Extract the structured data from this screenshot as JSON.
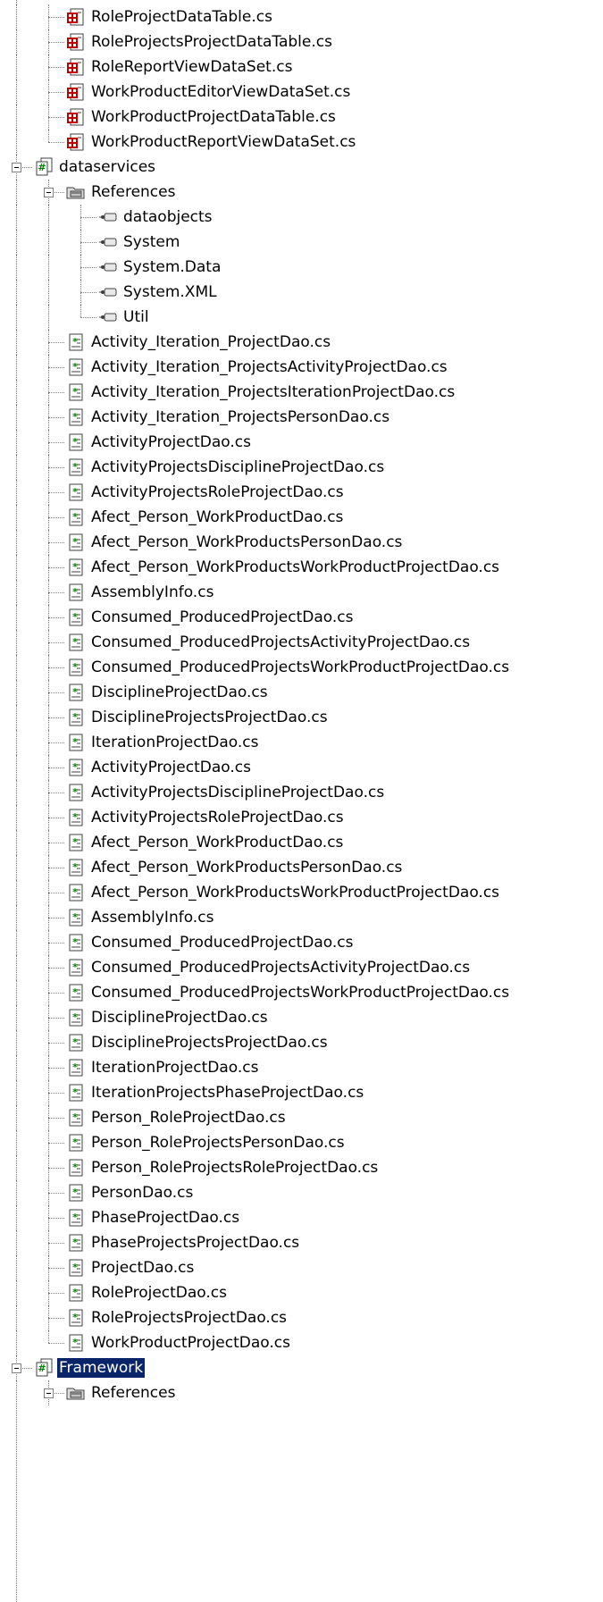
{
  "tree": {
    "nodes": [
      {
        "label": "RoleProjectDataTable.cs",
        "depth": 2,
        "type": "dataset",
        "expanded": false,
        "hasChildren": false,
        "last": false,
        "ancestorLastFlags": [
          false,
          false
        ]
      },
      {
        "label": "RoleProjectsProjectDataTable.cs",
        "depth": 2,
        "type": "dataset",
        "expanded": false,
        "hasChildren": false,
        "last": false,
        "ancestorLastFlags": [
          false,
          false
        ]
      },
      {
        "label": "RoleReportViewDataSet.cs",
        "depth": 2,
        "type": "dataset",
        "expanded": false,
        "hasChildren": false,
        "last": false,
        "ancestorLastFlags": [
          false,
          false
        ]
      },
      {
        "label": "WorkProductEditorViewDataSet.cs",
        "depth": 2,
        "type": "dataset",
        "expanded": false,
        "hasChildren": false,
        "last": false,
        "ancestorLastFlags": [
          false,
          false
        ]
      },
      {
        "label": "WorkProductProjectDataTable.cs",
        "depth": 2,
        "type": "dataset",
        "expanded": false,
        "hasChildren": false,
        "last": false,
        "ancestorLastFlags": [
          false,
          false
        ]
      },
      {
        "label": "WorkProductReportViewDataSet.cs",
        "depth": 2,
        "type": "dataset",
        "expanded": false,
        "hasChildren": false,
        "last": true,
        "ancestorLastFlags": [
          false,
          false
        ]
      },
      {
        "label": "dataservices",
        "depth": 1,
        "type": "project",
        "expanded": true,
        "hasChildren": true,
        "last": false,
        "ancestorLastFlags": [
          false
        ]
      },
      {
        "label": "References",
        "depth": 2,
        "type": "references",
        "expanded": true,
        "hasChildren": true,
        "last": false,
        "ancestorLastFlags": [
          false,
          false
        ]
      },
      {
        "label": "dataobjects",
        "depth": 3,
        "type": "reference",
        "expanded": false,
        "hasChildren": false,
        "last": false,
        "ancestorLastFlags": [
          false,
          false,
          false
        ]
      },
      {
        "label": "System",
        "depth": 3,
        "type": "reference",
        "expanded": false,
        "hasChildren": false,
        "last": false,
        "ancestorLastFlags": [
          false,
          false,
          false
        ]
      },
      {
        "label": "System.Data",
        "depth": 3,
        "type": "reference",
        "expanded": false,
        "hasChildren": false,
        "last": false,
        "ancestorLastFlags": [
          false,
          false,
          false
        ]
      },
      {
        "label": "System.XML",
        "depth": 3,
        "type": "reference",
        "expanded": false,
        "hasChildren": false,
        "last": false,
        "ancestorLastFlags": [
          false,
          false,
          false
        ]
      },
      {
        "label": "Util",
        "depth": 3,
        "type": "reference",
        "expanded": false,
        "hasChildren": false,
        "last": true,
        "ancestorLastFlags": [
          false,
          false,
          false
        ]
      },
      {
        "label": "Activity_Iteration_ProjectDao.cs",
        "depth": 2,
        "type": "csfile",
        "last": false
      },
      {
        "label": "Activity_Iteration_ProjectsActivityProjectDao.cs",
        "depth": 2,
        "type": "csfile",
        "last": false
      },
      {
        "label": "Activity_Iteration_ProjectsIterationProjectDao.cs",
        "depth": 2,
        "type": "csfile",
        "last": false
      },
      {
        "label": "Activity_Iteration_ProjectsPersonDao.cs",
        "depth": 2,
        "type": "csfile",
        "last": false
      },
      {
        "label": "ActivityProjectDao.cs",
        "depth": 2,
        "type": "csfile",
        "last": false
      },
      {
        "label": "ActivityProjectsDisciplineProjectDao.cs",
        "depth": 2,
        "type": "csfile",
        "last": false
      },
      {
        "label": "ActivityProjectsRoleProjectDao.cs",
        "depth": 2,
        "type": "csfile",
        "last": false
      },
      {
        "label": "Afect_Person_WorkProductDao.cs",
        "depth": 2,
        "type": "csfile",
        "last": false
      },
      {
        "label": "Afect_Person_WorkProductsPersonDao.cs",
        "depth": 2,
        "type": "csfile",
        "last": false
      },
      {
        "label": "Afect_Person_WorkProductsWorkProductProjectDao.cs",
        "depth": 2,
        "type": "csfile",
        "last": false
      },
      {
        "label": "AssemblyInfo.cs",
        "depth": 2,
        "type": "csfile",
        "last": false
      },
      {
        "label": "Consumed_ProducedProjectDao.cs",
        "depth": 2,
        "type": "csfile",
        "last": false
      },
      {
        "label": "Consumed_ProducedProjectsActivityProjectDao.cs",
        "depth": 2,
        "type": "csfile",
        "last": false
      },
      {
        "label": "Consumed_ProducedProjectsWorkProductProjectDao.cs",
        "depth": 2,
        "type": "csfile",
        "last": false
      },
      {
        "label": "DisciplineProjectDao.cs",
        "depth": 2,
        "type": "csfile",
        "last": false
      },
      {
        "label": "DisciplineProjectsProjectDao.cs",
        "depth": 2,
        "type": "csfile",
        "last": false
      },
      {
        "label": "IterationProjectDao.cs",
        "depth": 2,
        "type": "csfile",
        "last": false
      },
      {
        "label": "ActivityProjectDao.cs",
        "depth": 2,
        "type": "csfile",
        "last": false
      },
      {
        "label": "ActivityProjectsDisciplineProjectDao.cs",
        "depth": 2,
        "type": "csfile",
        "last": false
      },
      {
        "label": "ActivityProjectsRoleProjectDao.cs",
        "depth": 2,
        "type": "csfile",
        "last": false
      },
      {
        "label": "Afect_Person_WorkProductDao.cs",
        "depth": 2,
        "type": "csfile",
        "last": false
      },
      {
        "label": "Afect_Person_WorkProductsPersonDao.cs",
        "depth": 2,
        "type": "csfile",
        "last": false
      },
      {
        "label": "Afect_Person_WorkProductsWorkProductProjectDao.cs",
        "depth": 2,
        "type": "csfile",
        "last": false
      },
      {
        "label": "AssemblyInfo.cs",
        "depth": 2,
        "type": "csfile",
        "last": false
      },
      {
        "label": "Consumed_ProducedProjectDao.cs",
        "depth": 2,
        "type": "csfile",
        "last": false
      },
      {
        "label": "Consumed_ProducedProjectsActivityProjectDao.cs",
        "depth": 2,
        "type": "csfile",
        "last": false
      },
      {
        "label": "Consumed_ProducedProjectsWorkProductProjectDao.cs",
        "depth": 2,
        "type": "csfile",
        "last": false
      },
      {
        "label": "DisciplineProjectDao.cs",
        "depth": 2,
        "type": "csfile",
        "last": false
      },
      {
        "label": "DisciplineProjectsProjectDao.cs",
        "depth": 2,
        "type": "csfile",
        "last": false
      },
      {
        "label": "IterationProjectDao.cs",
        "depth": 2,
        "type": "csfile",
        "last": false
      },
      {
        "label": "IterationProjectsPhaseProjectDao.cs",
        "depth": 2,
        "type": "csfile",
        "last": false
      },
      {
        "label": "Person_RoleProjectDao.cs",
        "depth": 2,
        "type": "csfile",
        "last": false
      },
      {
        "label": "Person_RoleProjectsPersonDao.cs",
        "depth": 2,
        "type": "csfile",
        "last": false
      },
      {
        "label": "Person_RoleProjectsRoleProjectDao.cs",
        "depth": 2,
        "type": "csfile",
        "last": false
      },
      {
        "label": "PersonDao.cs",
        "depth": 2,
        "type": "csfile",
        "last": false
      },
      {
        "label": "PhaseProjectDao.cs",
        "depth": 2,
        "type": "csfile",
        "last": false
      },
      {
        "label": "PhaseProjectsProjectDao.cs",
        "depth": 2,
        "type": "csfile",
        "last": false
      },
      {
        "label": "ProjectDao.cs",
        "depth": 2,
        "type": "csfile",
        "last": false
      },
      {
        "label": "RoleProjectDao.cs",
        "depth": 2,
        "type": "csfile",
        "last": false
      },
      {
        "label": "RoleProjectsProjectDao.cs",
        "depth": 2,
        "type": "csfile",
        "last": false
      },
      {
        "label": "WorkProductProjectDao.cs",
        "depth": 2,
        "type": "csfile",
        "last": true
      },
      {
        "label": "Framework",
        "depth": 1,
        "type": "project",
        "expanded": true,
        "hasChildren": true,
        "last": false,
        "selected": true
      },
      {
        "label": "References",
        "depth": 2,
        "type": "references",
        "expanded": true,
        "hasChildren": true,
        "last": false
      }
    ]
  },
  "colors": {
    "selection_bg": "#0a246a",
    "selection_text": "#ffffff",
    "tree_line": "#808080",
    "csfile_green": "#008000",
    "dataset_red": "#c00000"
  },
  "icons": {
    "dataset": "dataset-file-icon",
    "project": "csharp-project-icon",
    "references": "references-folder-icon",
    "reference": "assembly-reference-icon",
    "csfile": "csharp-file-icon"
  }
}
